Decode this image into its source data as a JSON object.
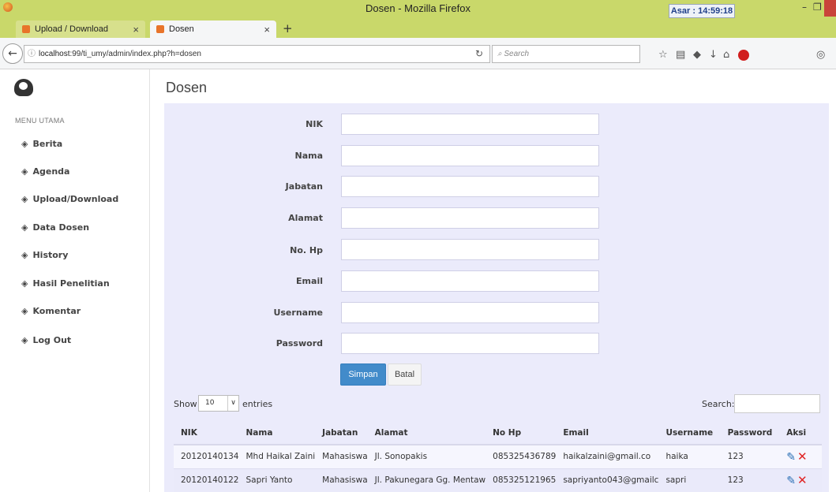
{
  "browser": {
    "window_title": "Dosen - Mozilla Firefox",
    "clock": "Asar : 14:59:18",
    "tabs": [
      {
        "label": "Upload / Download"
      },
      {
        "label": "Dosen"
      }
    ],
    "url_host": "localhost",
    "url_rest": ":99/ti_umy/admin/index.php?h=dosen",
    "search_placeholder": "Search"
  },
  "sidebar": {
    "menu_header": "MENU UTAMA",
    "items": [
      {
        "label": "Berita"
      },
      {
        "label": "Agenda"
      },
      {
        "label": "Upload/Download"
      },
      {
        "label": "Data Dosen"
      },
      {
        "label": "History"
      },
      {
        "label": "Hasil Penelitian"
      },
      {
        "label": "Komentar"
      },
      {
        "label": "Log Out"
      }
    ]
  },
  "page": {
    "title": "Dosen"
  },
  "form": {
    "fields": [
      {
        "label": "NIK",
        "value": ""
      },
      {
        "label": "Nama",
        "value": ""
      },
      {
        "label": "Jabatan",
        "value": ""
      },
      {
        "label": "Alamat",
        "value": ""
      },
      {
        "label": "No. Hp",
        "value": ""
      },
      {
        "label": "Email",
        "value": ""
      },
      {
        "label": "Username",
        "value": ""
      },
      {
        "label": "Password",
        "value": ""
      }
    ],
    "save_label": "Simpan",
    "cancel_label": "Batal"
  },
  "datatable": {
    "show_label": "Show",
    "entries_value": "10",
    "entries_label": "entries",
    "search_label": "Search:",
    "columns": [
      "NIK",
      "Nama",
      "Jabatan",
      "Alamat",
      "No Hp",
      "Email",
      "Username",
      "Password",
      "Aksi"
    ],
    "rows": [
      [
        "20120140134",
        "Mhd Haikal Zaini",
        "Mahasiswa",
        "Jl. Sonopakis",
        "085325436789",
        "haikalzaini@gmail.co",
        "haika",
        "123"
      ],
      [
        "20120140122",
        "Sapri Yanto",
        "Mahasiswa",
        "Jl. Pakunegara Gg. Mentaw",
        "085325121965",
        "sapriyanto043@gmailc",
        "sapri",
        "123"
      ]
    ]
  }
}
